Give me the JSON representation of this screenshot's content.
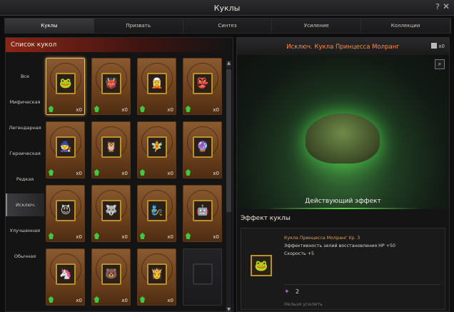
{
  "window": {
    "title": "Куклы",
    "help": "?",
    "close": "✕"
  },
  "tabs": [
    "Куклы",
    "Призвать",
    "Синтез",
    "Усиление",
    "Коллекции"
  ],
  "list": {
    "title": "Список кукол",
    "categories": [
      "Все",
      "Мифическая",
      "Легендарная",
      "Героическая",
      "Редкая",
      "Исключ.",
      "Улучшенная",
      "Обычная"
    ],
    "active_category": "Исключ.",
    "cards": [
      {
        "icon": "🐸",
        "count": "x0"
      },
      {
        "icon": "👹",
        "count": "x0"
      },
      {
        "icon": "🧝",
        "count": "x0"
      },
      {
        "icon": "👺",
        "count": "x0"
      },
      {
        "icon": "🧙",
        "count": "x0"
      },
      {
        "icon": "🦉",
        "count": "x0"
      },
      {
        "icon": "🧚",
        "count": "x0"
      },
      {
        "icon": "🔮",
        "count": "x0"
      },
      {
        "icon": "😈",
        "count": "x0"
      },
      {
        "icon": "🐺",
        "count": "x0"
      },
      {
        "icon": "🧞",
        "count": "x0"
      },
      {
        "icon": "🤖",
        "count": "x0"
      },
      {
        "icon": "🦄",
        "count": "x0"
      },
      {
        "icon": "🐻",
        "count": "x0"
      },
      {
        "icon": "👸",
        "count": "x0"
      },
      {
        "icon": "",
        "count": ""
      }
    ]
  },
  "detail": {
    "name": "Исключ. Кукла Принцесса Молранг",
    "owned": "x0",
    "active_effect_label": "Действующий эффект",
    "effect_section_title": "Эффект куклы",
    "effect_name": "Кукла Принцесса Молранг Ур. 3",
    "effect_line1": "Эффективность зелий восстановления HP +50",
    "effect_line2": "Скорость +5",
    "star_count": "2",
    "upgrade_status": "Нельзя усилить"
  },
  "colors": {
    "accent_orange": "#ff8a4a",
    "rarity_gem": "#3fc840",
    "list_header": "#8a2618"
  }
}
